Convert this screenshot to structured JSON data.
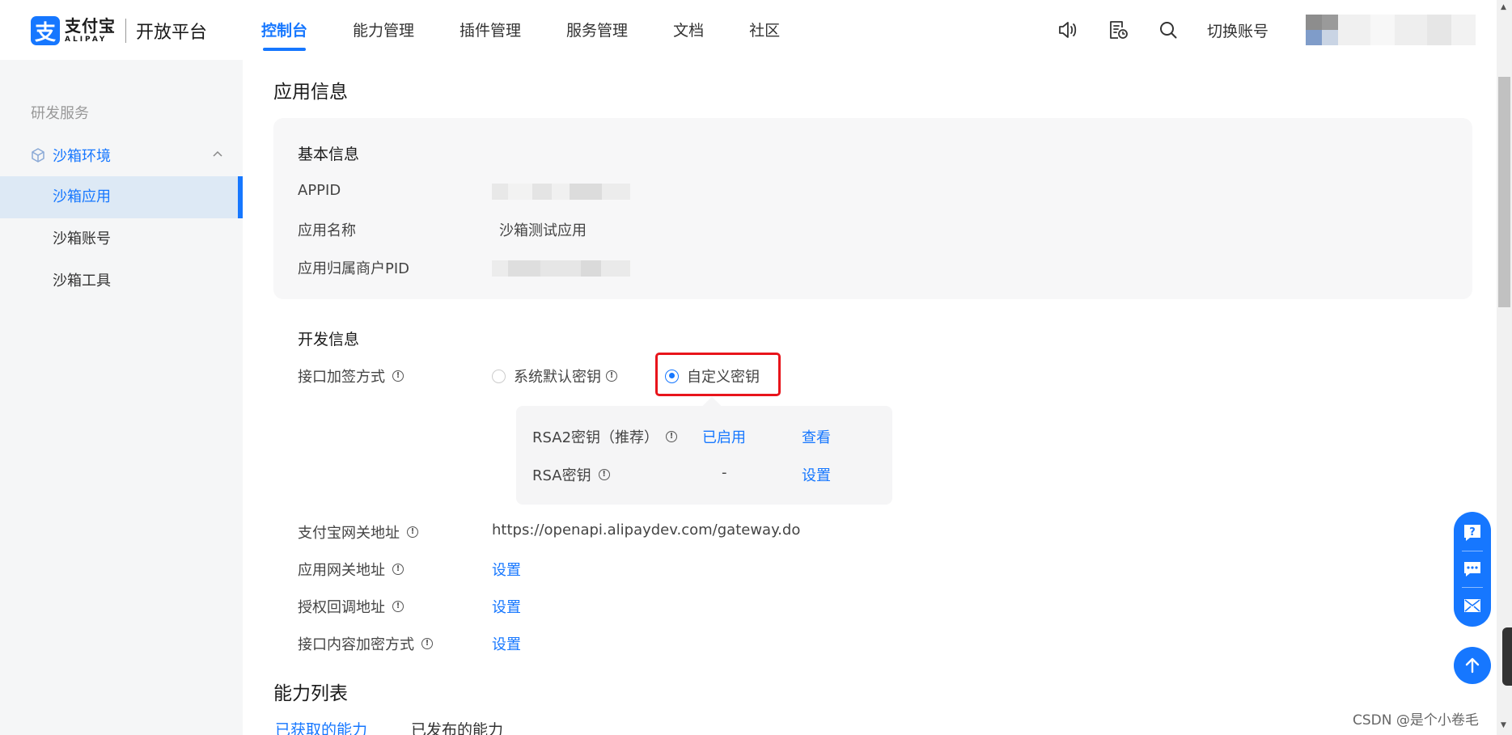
{
  "header": {
    "logo_cn": "支付宝",
    "logo_en": "ALIPAY",
    "platform": "开放平台",
    "nav": [
      {
        "label": "控制台",
        "active": true
      },
      {
        "label": "能力管理",
        "active": false
      },
      {
        "label": "插件管理",
        "active": false
      },
      {
        "label": "服务管理",
        "active": false
      },
      {
        "label": "文档",
        "active": false
      },
      {
        "label": "社区",
        "active": false
      }
    ],
    "icons": [
      "speaker-icon",
      "document-clock-icon",
      "search-icon"
    ],
    "switch_account": "切换账号"
  },
  "sidebar": {
    "group": "研发服务",
    "parent": "沙箱环境",
    "items": [
      {
        "label": "沙箱应用",
        "active": true
      },
      {
        "label": "沙箱账号",
        "active": false
      },
      {
        "label": "沙箱工具",
        "active": false
      }
    ]
  },
  "main": {
    "title": "应用信息",
    "basic": {
      "title": "基本信息",
      "appid_label": "APPID",
      "appname_label": "应用名称",
      "appname_value": "沙箱测试应用",
      "pid_label": "应用归属商户PID"
    },
    "dev": {
      "title": "开发信息",
      "sign_label": "接口加签方式",
      "opt_default": "系统默认密钥",
      "opt_custom": "自定义密钥",
      "rsa2_label": "RSA2密钥（推荐）",
      "rsa2_status": "已启用",
      "rsa2_action": "查看",
      "rsa_label": "RSA密钥",
      "rsa_status": "-",
      "rsa_action": "设置",
      "gateway_label": "支付宝网关地址",
      "gateway_value": "https://openapi.alipaydev.com/gateway.do",
      "app_gateway_label": "应用网关地址",
      "app_gateway_action": "设置",
      "callback_label": "授权回调地址",
      "callback_action": "设置",
      "encrypt_label": "接口内容加密方式",
      "encrypt_action": "设置"
    },
    "abilities": {
      "title": "能力列表",
      "tabs": [
        "已获取的能力",
        "已发布的能力"
      ]
    }
  },
  "watermark": "CSDN @是个小卷毛",
  "colors": {
    "accent": "#1677ff",
    "highlight": "#e8141b"
  }
}
